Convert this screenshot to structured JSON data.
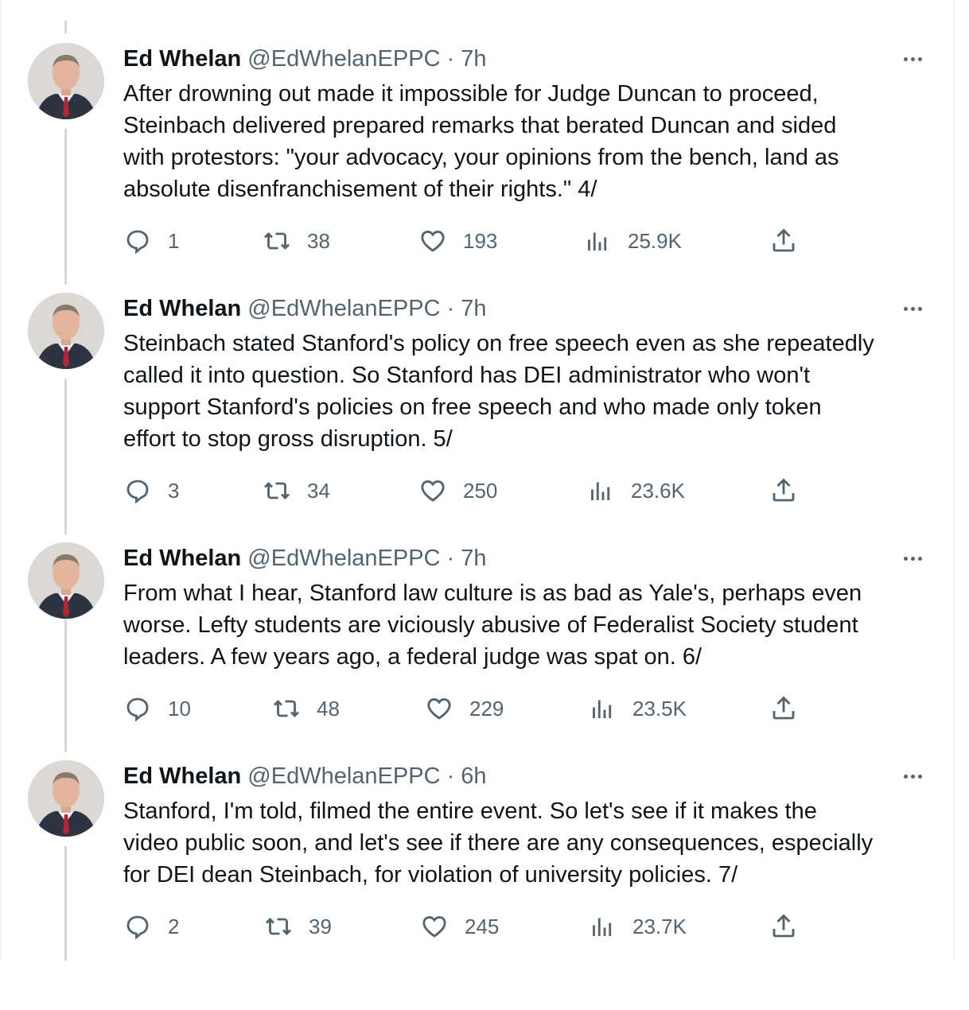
{
  "tweets": [
    {
      "name": "Ed Whelan",
      "handle": "@EdWhelanEPPC",
      "time": "7h",
      "text_lines": [
        "After drowning out made it impossible for Judge Duncan to proceed,",
        "Steinbach delivered prepared remarks that berated Duncan and sided",
        "with protestors: \"your advocacy, your opinions from the bench, land as",
        "absolute disenfranchisement of their rights.\" 4/"
      ],
      "replies": "1",
      "retweets": "38",
      "likes": "193",
      "views": "25.9K"
    },
    {
      "name": "Ed Whelan",
      "handle": "@EdWhelanEPPC",
      "time": "7h",
      "text_lines": [
        "Steinbach stated Stanford's policy on free speech even as she repeatedly",
        "called it into question. So Stanford has DEI administrator who won't",
        "support Stanford's policies on free speech and who made only token",
        "effort to stop gross disruption. 5/"
      ],
      "replies": "3",
      "retweets": "34",
      "likes": "250",
      "views": "23.6K"
    },
    {
      "name": "Ed Whelan",
      "handle": "@EdWhelanEPPC",
      "time": "7h",
      "text_lines": [
        "From what I hear, Stanford law culture is as bad as Yale's, perhaps even",
        "worse. Lefty students are viciously abusive of Federalist Society student",
        "leaders. A few years ago, a federal judge was spat on. 6/"
      ],
      "replies": "10",
      "retweets": "48",
      "likes": "229",
      "views": "23.5K"
    },
    {
      "name": "Ed Whelan",
      "handle": "@EdWhelanEPPC",
      "time": "6h",
      "text_lines": [
        "Stanford, I'm told, filmed the entire event. So let's see if it makes the",
        "video public soon, and let's see if there are any consequences, especially",
        "for DEI dean Steinbach, for violation of university policies. 7/"
      ],
      "replies": "2",
      "retweets": "39",
      "likes": "245",
      "views": "23.7K"
    }
  ],
  "separator": " · ",
  "icons": [
    "reply-icon",
    "retweet-icon",
    "like-icon",
    "views-icon",
    "share-icon",
    "more-icon"
  ],
  "colors": {
    "text": "#0f1419",
    "secondary": "#536471",
    "thread_line": "#cfd9de"
  }
}
